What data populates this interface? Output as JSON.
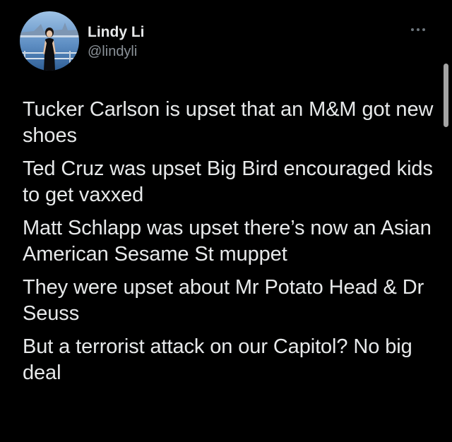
{
  "author": {
    "name": "Lindy Li",
    "handle": "@lindyli"
  },
  "icons": {
    "more": "more-horizontal-icon",
    "avatar": "profile-photo"
  },
  "tweet": {
    "paragraphs": [
      "Tucker Carlson is upset that an M&M got new shoes",
      "Ted Cruz was upset Big Bird encouraged kids to get vaxxed",
      "Matt Schlapp was upset there’s now an Asian American Sesame St muppet",
      "They were upset about Mr Potato Head & Dr Seuss",
      "But a terrorist attack on our Capitol? No big deal"
    ]
  },
  "colors": {
    "background": "#000000",
    "text_primary": "#e7e9ea",
    "text_secondary": "#8b9299"
  }
}
